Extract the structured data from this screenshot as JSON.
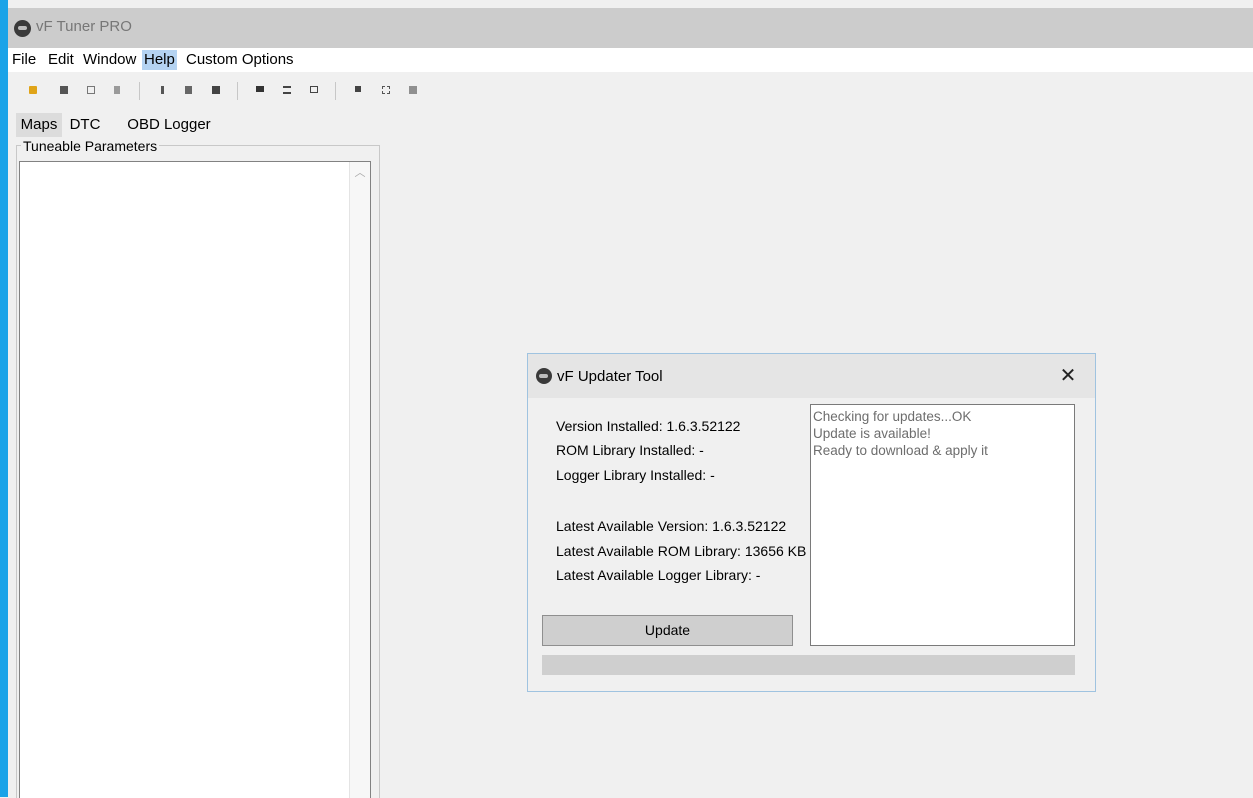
{
  "app": {
    "title": "vF Tuner PRO"
  },
  "menu": {
    "items": [
      {
        "label": "File"
      },
      {
        "label": "Edit"
      },
      {
        "label": "Window"
      },
      {
        "label": "Help",
        "active": true
      },
      {
        "label": "Custom Options"
      }
    ]
  },
  "toolbar": {
    "icons": [
      "open-folder-icon",
      "save-icon",
      "save-as-icon",
      "properties-icon",
      "cut-icon",
      "copy-icon",
      "paste-icon",
      "compare-icon",
      "table-view-icon",
      "window-icon",
      "stop-icon",
      "grid-icon",
      "map-editor-icon"
    ]
  },
  "tabs": [
    {
      "label": "Maps",
      "active": true
    },
    {
      "label": "DTC"
    },
    {
      "label": "OBD Logger"
    }
  ],
  "params": {
    "group_label": "Tuneable Parameters"
  },
  "dialog": {
    "title": "vF Updater Tool",
    "close_symbol": "✕",
    "installed": {
      "version": "Version Installed: 1.6.3.52122",
      "rom": "ROM Library Installed: -",
      "logger": "Logger Library Installed: -"
    },
    "latest": {
      "version": "Latest Available Version: 1.6.3.52122",
      "rom": "Latest Available ROM Library: 13656 KB",
      "logger": "Latest Available Logger Library: -"
    },
    "update_label": "Update",
    "log": [
      "Checking for updates...OK",
      "Update is available!",
      "Ready to download & apply it"
    ],
    "progress": 0
  },
  "colors": {
    "accent": "#1aa3e8",
    "titlebar": "#cccccc",
    "menu_highlight": "#b4d3f2",
    "progress_track": "#cfcfcf"
  }
}
